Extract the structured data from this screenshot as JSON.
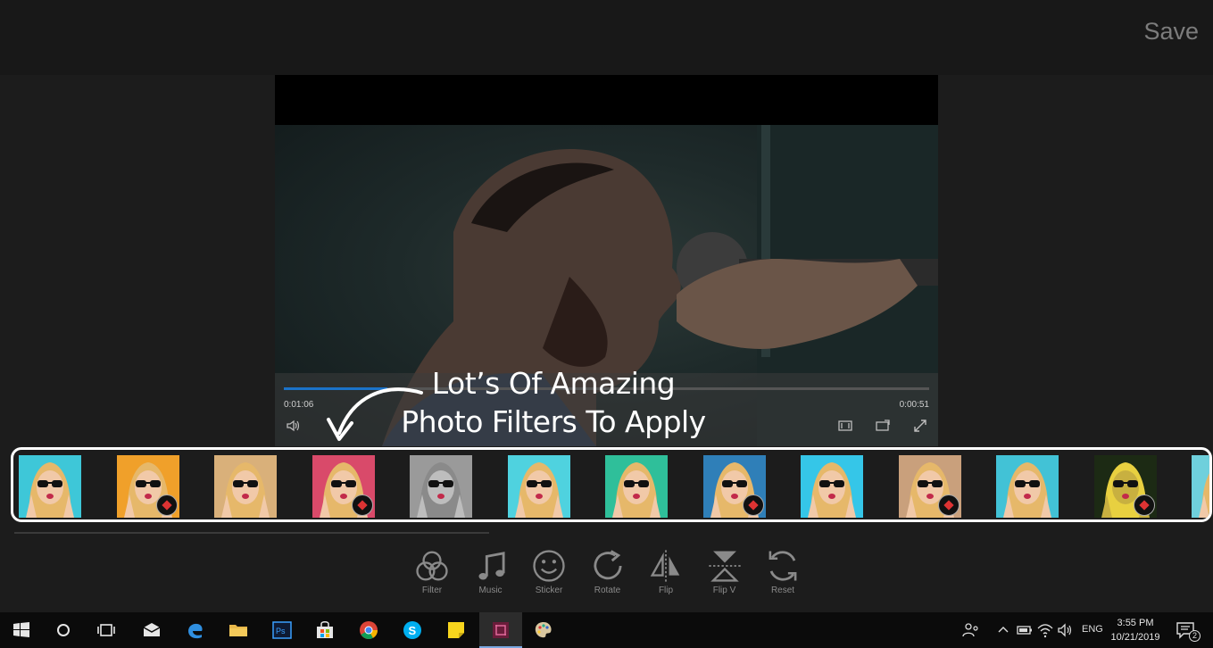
{
  "app": {
    "save_label": "Save"
  },
  "player": {
    "elapsed": "0:01:06",
    "remaining": "0:00:51",
    "progress": 0.16
  },
  "overlay": {
    "line1": "Lot’s Of Amazing",
    "line2": "Photo Filters To Apply"
  },
  "filters": [
    {
      "tint": "#3ec7d8",
      "badge": false
    },
    {
      "tint": "#f0a02a",
      "badge": true
    },
    {
      "tint": "#d9b07a",
      "badge": false
    },
    {
      "tint": "#d94a6a",
      "badge": true
    },
    {
      "tint": "#9a9a9a",
      "badge": false
    },
    {
      "tint": "#4fd2df",
      "badge": false
    },
    {
      "tint": "#2fbf9a",
      "badge": false
    },
    {
      "tint": "#2f7fb8",
      "badge": true
    },
    {
      "tint": "#35c6e8",
      "badge": false
    },
    {
      "tint": "#c9a07c",
      "badge": true
    },
    {
      "tint": "#42c2d6",
      "badge": false
    },
    {
      "tint": "#1c2a14",
      "badge": true
    },
    {
      "tint": "#6fd0dc",
      "badge": false
    }
  ],
  "tools": [
    {
      "id": "filter",
      "label": "Filter",
      "icon": "filter-icon"
    },
    {
      "id": "music",
      "label": "Music",
      "icon": "music-icon"
    },
    {
      "id": "sticker",
      "label": "Sticker",
      "icon": "sticker-icon"
    },
    {
      "id": "rotate",
      "label": "Rotate",
      "icon": "rotate-icon"
    },
    {
      "id": "flip",
      "label": "Flip",
      "icon": "flip-icon"
    },
    {
      "id": "flipv",
      "label": "Flip V",
      "icon": "flip-vertical-icon"
    },
    {
      "id": "reset",
      "label": "Reset",
      "icon": "reset-icon"
    }
  ],
  "taskbar": {
    "language": "ENG",
    "time": "3:55 PM",
    "date": "10/21/2019",
    "notifications": "2"
  },
  "colors": {
    "accent": "#1b73c9",
    "background": "#1c1c1c",
    "taskbar": "#0b0b0b"
  }
}
